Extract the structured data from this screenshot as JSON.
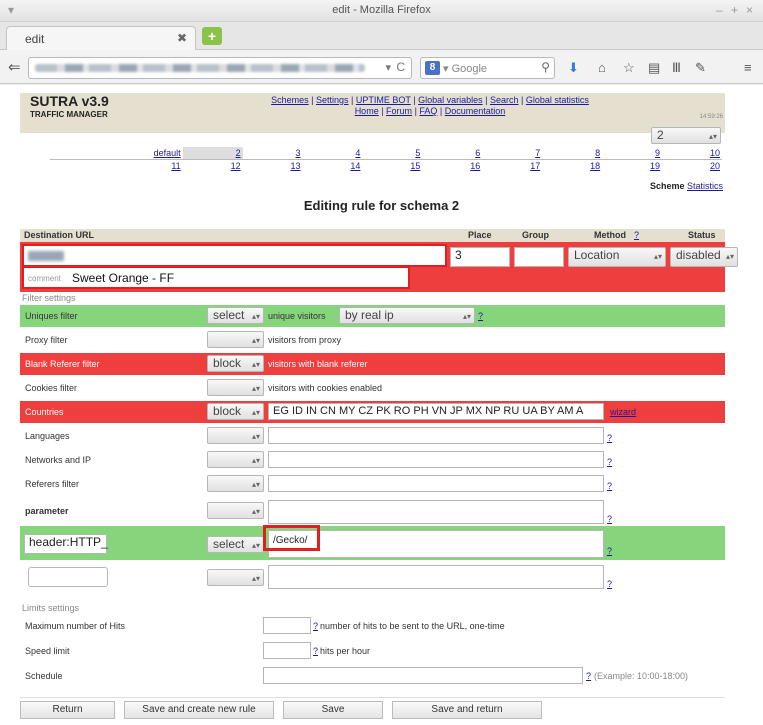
{
  "window": {
    "title": "edit - Mozilla Firefox"
  },
  "tab": {
    "label": "edit"
  },
  "search": {
    "engine_label": "Google"
  },
  "app": {
    "name": "SUTRA v3.9",
    "subtitle": "TRAFFIC MANAGER",
    "time": "14:59:26"
  },
  "toplinks": {
    "row1": [
      "Schemes",
      "Settings",
      "UPTIME BOT",
      "Global variables",
      "Search",
      "Global statistics"
    ],
    "row2": [
      "Home",
      "Forum",
      "FAQ",
      "Documentation"
    ]
  },
  "schema_select": "2",
  "schemas_row1": [
    "default",
    "2",
    "3",
    "4",
    "5",
    "6",
    "7",
    "8",
    "9",
    "10"
  ],
  "schemas_row2": [
    "11",
    "12",
    "13",
    "14",
    "15",
    "16",
    "17",
    "18",
    "19",
    "20"
  ],
  "scheme_stats": {
    "label": "Scheme",
    "link": "Statistics"
  },
  "edit_title": "Editing rule for schema 2",
  "columns": {
    "dest": "Destination URL",
    "place": "Place",
    "group": "Group",
    "method": "Method",
    "method_q": "?",
    "status": "Status"
  },
  "rule": {
    "place": "3",
    "group": "",
    "method": "Location",
    "status": "disabled",
    "comment_label": "comment",
    "comment": "Sweet Orange - FF"
  },
  "filter_settings": "Filter settings",
  "filters": {
    "uniques": {
      "label": "Uniques filter",
      "select": "select",
      "text": "unique visitors",
      "sub": "by real ip",
      "q": "?"
    },
    "proxy": {
      "label": "Proxy filter",
      "text": "visitors from proxy"
    },
    "blank": {
      "label": "Blank Referer filter",
      "select": "block",
      "text": "visitors with blank referer"
    },
    "cookies": {
      "label": "Cookies filter",
      "text": "visitors with cookies enabled"
    },
    "countries": {
      "label": "Countries",
      "select": "block",
      "value": "EG ID IN CN MY CZ PK RO PH VN JP MX NP RU UA BY AM A",
      "wizard": "wizard"
    },
    "languages": {
      "label": "Languages",
      "q": "?"
    },
    "networks": {
      "label": "Networks and IP",
      "q": "?"
    },
    "referers": {
      "label": "Referers filter",
      "q": "?"
    },
    "parameter": {
      "label": "parameter",
      "q": "?"
    },
    "header": {
      "input": "header:HTTP_",
      "select": "select",
      "value": "/Gecko/",
      "q": "?"
    },
    "extra": {
      "q": "?"
    }
  },
  "limits_settings": "Limits settings",
  "limits": {
    "max_hits": {
      "label": "Maximum number of Hits",
      "q": "?",
      "text": "number of hits to be sent to the URL, one-time"
    },
    "speed": {
      "label": "Speed limit",
      "q": "?",
      "text": "hits per hour"
    },
    "schedule": {
      "label": "Schedule",
      "q": "?",
      "text": "(Example: 10:00-18:00)"
    }
  },
  "buttons": {
    "return": "Return",
    "save_new": "Save and create new rule",
    "save": "Save",
    "save_return": "Save and return"
  },
  "colors": {
    "green": "#86d47c",
    "red": "#ee3e3e",
    "highlight_box": "#e02020",
    "header_band": "#e5dfd0"
  }
}
